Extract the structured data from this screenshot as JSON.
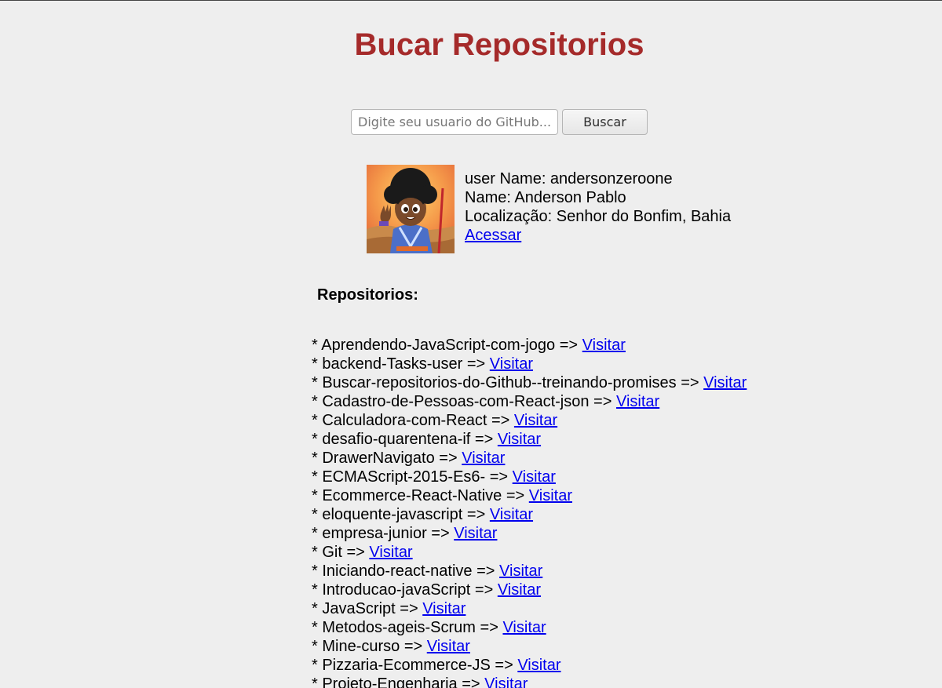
{
  "page": {
    "title": "Bucar Repositorios"
  },
  "search": {
    "placeholder": "Digite seu usuario do GitHub...",
    "value": "",
    "button_label": "Buscar"
  },
  "profile": {
    "username_line": "user Name: andersonzeroone",
    "name_line": "Name: Anderson Pablo",
    "location_line": "Localização: Senhor do Bonfim, Bahia",
    "link_label": "Acessar"
  },
  "repos": {
    "heading": "Repositorios:",
    "bullet": "* ",
    "separator": " => ",
    "link_label": "Visitar",
    "items": [
      "Aprendendo-JavaScript-com-jogo",
      "backend-Tasks-user",
      "Buscar-repositorios-do-Github--treinando-promises",
      "Cadastro-de-Pessoas-com-React-json",
      "Calculadora-com-React",
      "desafio-quarentena-if",
      "DrawerNavigato",
      "ECMAScript-2015-Es6-",
      "Ecommerce-React-Native",
      "eloquente-javascript",
      "empresa-junior",
      "Git",
      "Iniciando-react-native",
      "Introducao-javaScript",
      "JavaScript",
      "Metodos-ageis-Scrum",
      "Mine-curso",
      "Pizzaria-Ecommerce-JS",
      "Projeto-Engenharia"
    ]
  }
}
